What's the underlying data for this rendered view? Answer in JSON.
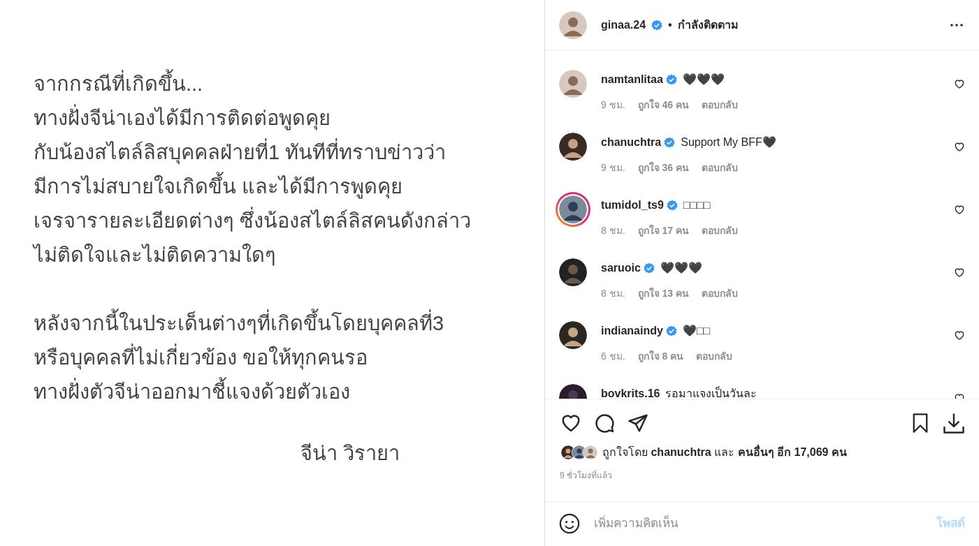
{
  "post_image": {
    "paragraphs": [
      [
        "จากกรณีที่เกิดขึ้น...",
        "ทางฝั่งจีน่าเองได้มีการติดต่อพูดคุย",
        "กับน้องสไตล์ลิสบุคคลฝ่ายที่1 ทันทีที่ทราบข่าวว่า",
        "มีการไม่สบายใจเกิดขึ้น และได้มีการพูดคุย",
        "เจรจารายละเอียดต่างๆ ซึ่งน้องสไตล์ลิสคนดังกล่าว",
        "ไม่ติดใจและไม่ติดความใดๆ"
      ],
      [
        "หลังจากนี้ในประเด็นต่างๆที่เกิดขึ้นโดยบุคคลที่3",
        "หรือบุคคลที่ไม่เกี่ยวข้อง ขอให้ทุกคนรอ",
        "ทางฝั่งตัวจีน่าออกมาชี้แจงด้วยตัวเอง"
      ]
    ],
    "signature": "จีน่า วิรายา"
  },
  "header": {
    "username": "ginaa.24",
    "verified": true,
    "separator": "•",
    "follow_status": "กำลังติดตาม"
  },
  "comments": [
    {
      "username": "namtanlitaa",
      "verified": true,
      "story_ring": false,
      "text": "🖤🖤🖤",
      "time": "9 ชม.",
      "likes": "ถูกใจ 46 คน",
      "reply": "ตอบกลับ"
    },
    {
      "username": "chanuchtra",
      "verified": true,
      "story_ring": false,
      "text": "Support My BFF🖤",
      "time": "9 ชม.",
      "likes": "ถูกใจ 36 คน",
      "reply": "ตอบกลับ"
    },
    {
      "username": "tumidol_ts9",
      "verified": true,
      "story_ring": true,
      "text": "□□□□",
      "time": "8 ชม.",
      "likes": "ถูกใจ 17 คน",
      "reply": "ตอบกลับ"
    },
    {
      "username": "saruoic",
      "verified": true,
      "story_ring": false,
      "text": "🖤🖤🖤",
      "time": "8 ชม.",
      "likes": "ถูกใจ 13 คน",
      "reply": "ตอบกลับ"
    },
    {
      "username": "indianaindy",
      "verified": true,
      "story_ring": false,
      "text": "🖤□□",
      "time": "6 ชม.",
      "likes": "ถูกใจ 8 คน",
      "reply": "ตอบกลับ"
    },
    {
      "username": "bovkrits.16",
      "verified": false,
      "story_ring": false,
      "text": "รอมาแจงเป็นวันละ"
    }
  ],
  "liked_by": "ถูกใจโดย **chanuchtra** และ **คนอื่นๆ อีก 17,069 คน**",
  "posted": "9 ชั่วโมงที่แล้ว",
  "comment_box": {
    "placeholder": "เพิ่มความคิดเห็น",
    "post_button": "โพสต์",
    "disabled": true
  }
}
